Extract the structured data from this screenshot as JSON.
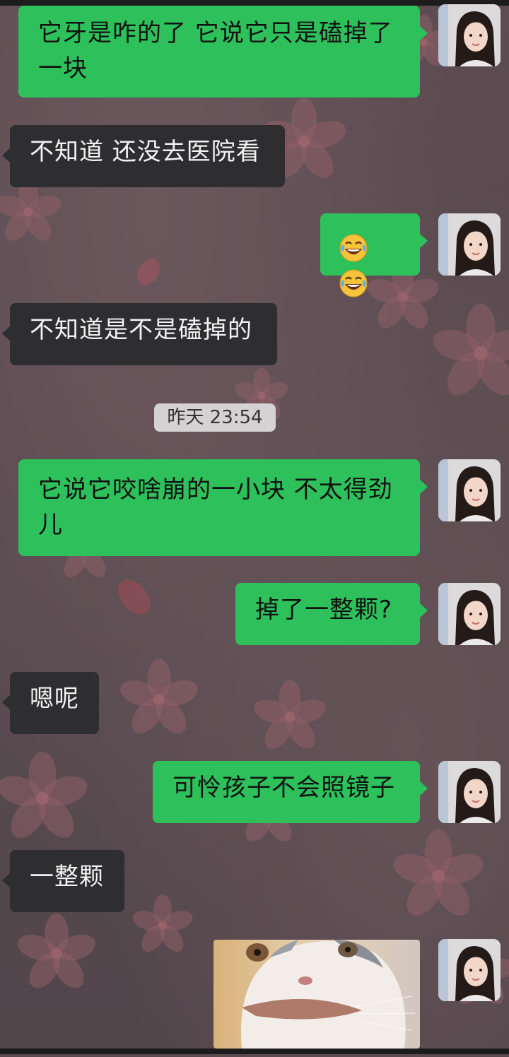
{
  "timestamp": "昨天 23:54",
  "messages": [
    {
      "side": "right",
      "text_line1": "它牙是咋的了 它说它只是磕掉了",
      "text_line2": "一块"
    },
    {
      "side": "left",
      "text": "不知道 还没去医院看"
    },
    {
      "side": "right",
      "emoji": [
        "face-with-tears-of-joy",
        "face-with-tears-of-joy"
      ]
    },
    {
      "side": "left",
      "text": "不知道是不是磕掉的"
    },
    {
      "side": "right",
      "text_line1": "它说它咬啥崩的一小块 不太得劲",
      "text_line2": "儿"
    },
    {
      "side": "right",
      "text": "掉了一整颗?"
    },
    {
      "side": "left",
      "text": "嗯呢"
    },
    {
      "side": "right",
      "text": "可怜孩子不会照镜子"
    },
    {
      "side": "left",
      "text": "一整颗"
    },
    {
      "side": "right",
      "sticker": "cat-sticker"
    }
  ],
  "colors": {
    "outgoing_bubble": "#2ec05a",
    "incoming_bubble": "#2e2d2f",
    "background": "#5a4b50"
  }
}
